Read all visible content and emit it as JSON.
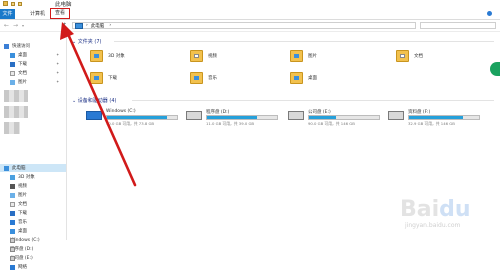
{
  "window": {
    "title": "此电脑"
  },
  "ribbon": {
    "tabs": [
      "文件",
      "计算机",
      "查看"
    ]
  },
  "address": {
    "path": "此电脑",
    "separator": "›"
  },
  "sidebar": {
    "items": [
      {
        "label": "快速访问",
        "icon": "star-icon"
      },
      {
        "label": "桌面",
        "icon": "desktop-icon"
      },
      {
        "label": "下载",
        "icon": "download-icon"
      },
      {
        "label": "文档",
        "icon": "document-icon"
      },
      {
        "label": "图片",
        "icon": "picture-icon"
      },
      {
        "label": "此电脑",
        "icon": "pc-icon"
      },
      {
        "label": "3D 对象",
        "icon": "3d-objects-icon"
      },
      {
        "label": "视频",
        "icon": "video-icon"
      },
      {
        "label": "图片",
        "icon": "picture-icon"
      },
      {
        "label": "文档",
        "icon": "document-icon"
      },
      {
        "label": "下载",
        "icon": "download-icon"
      },
      {
        "label": "音乐",
        "icon": "music-icon"
      },
      {
        "label": "桌面",
        "icon": "desktop-icon"
      },
      {
        "label": "Windows (C:)",
        "icon": "drive-icon"
      },
      {
        "label": "程序盘 (D:)",
        "icon": "drive-icon"
      },
      {
        "label": "公司盘 (E:)",
        "icon": "drive-icon"
      },
      {
        "label": "网络",
        "icon": "network-icon"
      }
    ]
  },
  "folders": {
    "header": "文件夹 (7)",
    "items": [
      "3D 对象",
      "视频",
      "图片",
      "文档",
      "下载",
      "音乐",
      "桌面"
    ]
  },
  "drives": {
    "header": "设备和驱动器 (4)",
    "items": [
      {
        "name": "Windows (C:)",
        "free": "10.0 GB 可用，共 73.8 GB",
        "used_fraction": 0.86
      },
      {
        "name": "程序盘 (D:)",
        "free": "11.0 GB 可用，共 39.0 GB",
        "used_fraction": 0.72
      },
      {
        "name": "公司盘 (E:)",
        "free": "90.0 GB 可用，共 146 GB",
        "used_fraction": 0.38
      },
      {
        "name": "资料盘 (F:)",
        "free": "32.9 GB 可用，共 146 GB",
        "used_fraction": 0.77
      }
    ]
  },
  "colors": {
    "accent": "#1979ca",
    "annotation": "#d11a1a",
    "bar_fill": "#26a0da"
  }
}
